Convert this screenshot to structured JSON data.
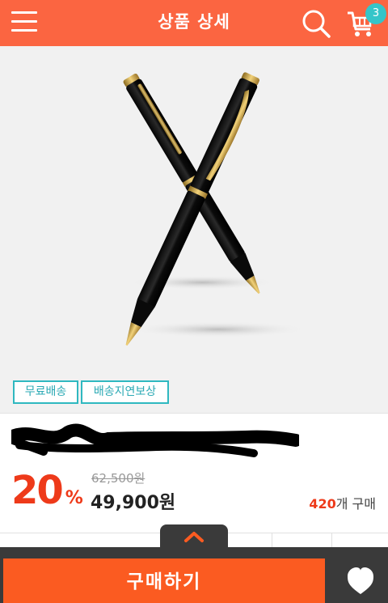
{
  "header": {
    "title": "상품 상세",
    "cart_count": "3",
    "menu_icon": "hamburger-menu-icon",
    "search_icon": "search-icon",
    "cart_icon": "cart-icon",
    "accent_color": "#fb6541"
  },
  "product": {
    "tags": [
      "무료배송",
      "배송지연보상"
    ],
    "name": "",
    "discount": "20",
    "discount_unit": "%",
    "original_price": "62,500원",
    "sale_price": "49,900원",
    "purchase_count": "420",
    "purchase_suffix": "개 구매"
  },
  "actions": {
    "buy_label": "구매하기",
    "expand_icon": "chevron-up-icon",
    "wish_icon": "heart-icon",
    "buy_color": "#fb5b21"
  }
}
